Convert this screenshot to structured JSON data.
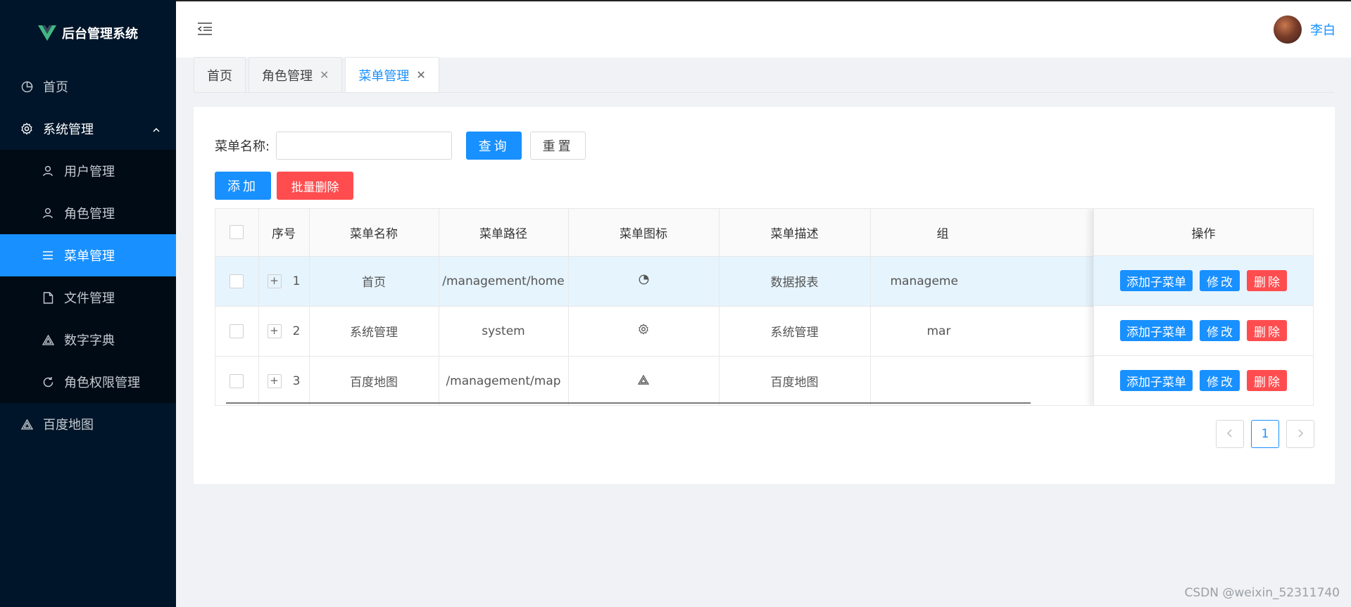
{
  "app": {
    "title": "后台管理系统"
  },
  "sidebar": {
    "items": [
      {
        "label": "首页",
        "icon": "pie-chart-icon"
      },
      {
        "label": "系统管理",
        "icon": "gear-icon",
        "expanded": true,
        "children": [
          {
            "label": "用户管理",
            "icon": "user-icon"
          },
          {
            "label": "角色管理",
            "icon": "user-icon"
          },
          {
            "label": "菜单管理",
            "icon": "menu-icon",
            "active": true
          },
          {
            "label": "文件管理",
            "icon": "file-icon"
          },
          {
            "label": "数字字典",
            "icon": "warning-triangle-icon"
          },
          {
            "label": "角色权限管理",
            "icon": "refresh-icon"
          }
        ]
      },
      {
        "label": "百度地图",
        "icon": "warning-triangle-icon"
      }
    ]
  },
  "header": {
    "username": "李白"
  },
  "tabs": [
    {
      "label": "首页",
      "closable": false
    },
    {
      "label": "角色管理",
      "closable": true
    },
    {
      "label": "菜单管理",
      "closable": true,
      "active": true
    }
  ],
  "search": {
    "label": "菜单名称:",
    "value": "",
    "placeholder": "",
    "query_label": "查询",
    "reset_label": "重置"
  },
  "actions": {
    "add_label": "添加",
    "batch_delete_label": "批量删除"
  },
  "table": {
    "columns": [
      "序号",
      "菜单名称",
      "菜单路径",
      "菜单图标",
      "菜单描述",
      "组"
    ],
    "action_column": "操作",
    "rows": [
      {
        "index": "1",
        "name": "首页",
        "path": "/management/home",
        "icon": "pie-chart-icon",
        "desc": "数据报表",
        "group": "manageme"
      },
      {
        "index": "2",
        "name": "系统管理",
        "path": "system",
        "icon": "gear-icon",
        "desc": "系统管理",
        "group": "mar"
      },
      {
        "index": "3",
        "name": "百度地图",
        "path": "/management/map",
        "icon": "warning-triangle-icon",
        "desc": "百度地图",
        "group": ""
      }
    ],
    "row_actions": {
      "add_child": "添加子菜单",
      "edit": "修改",
      "delete": "删除"
    }
  },
  "pagination": {
    "current": "1"
  },
  "watermark": "CSDN @weixin_52311740",
  "colors": {
    "sidebar_bg": "#001529",
    "submenu_bg": "#000b16",
    "primary": "#1890ff",
    "danger": "#ff4d4f",
    "row_highlight": "#e6f4fd",
    "logo_green": "#41b883"
  }
}
